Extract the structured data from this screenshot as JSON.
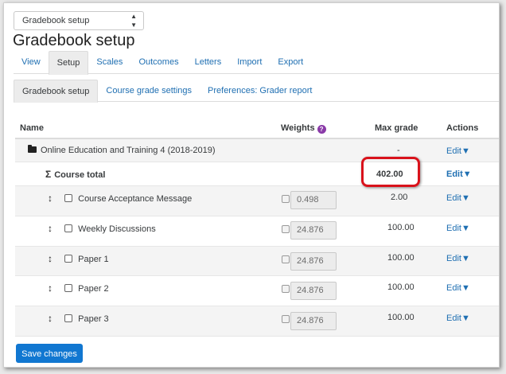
{
  "view_selector": {
    "value": "Gradebook setup"
  },
  "page_title": "Gradebook setup",
  "tabs": [
    {
      "label": "View"
    },
    {
      "label": "Setup",
      "active": true
    },
    {
      "label": "Scales"
    },
    {
      "label": "Outcomes"
    },
    {
      "label": "Letters"
    },
    {
      "label": "Import"
    },
    {
      "label": "Export"
    }
  ],
  "subtabs": [
    {
      "label": "Gradebook setup",
      "active": true
    },
    {
      "label": "Course grade settings"
    },
    {
      "label": "Preferences: Grader report"
    }
  ],
  "table": {
    "headers": {
      "name": "Name",
      "weights": "Weights",
      "max_grade": "Max grade",
      "actions": "Actions"
    },
    "category": {
      "name": "Online Education and Training 4 (2018-2019)",
      "max_grade": "-",
      "action": "Edit"
    },
    "course_total": {
      "name": "Course total",
      "max_grade": "402.00",
      "action": "Edit"
    },
    "items": [
      {
        "name": "Course Acceptance Message",
        "weight": "0.498",
        "max_grade": "2.00",
        "action": "Edit"
      },
      {
        "name": "Weekly Discussions",
        "weight": "24.876",
        "max_grade": "100.00",
        "action": "Edit"
      },
      {
        "name": "Paper 1",
        "weight": "24.876",
        "max_grade": "100.00",
        "action": "Edit"
      },
      {
        "name": "Paper 2",
        "weight": "24.876",
        "max_grade": "100.00",
        "action": "Edit"
      },
      {
        "name": "Paper 3",
        "weight": "24.876",
        "max_grade": "100.00",
        "action": "Edit"
      }
    ]
  },
  "save_button": "Save changes",
  "colors": {
    "link": "#1f6fb2",
    "primary_button": "#1177d1",
    "highlight": "#d9121b",
    "help_icon": "#8a3aa8"
  }
}
